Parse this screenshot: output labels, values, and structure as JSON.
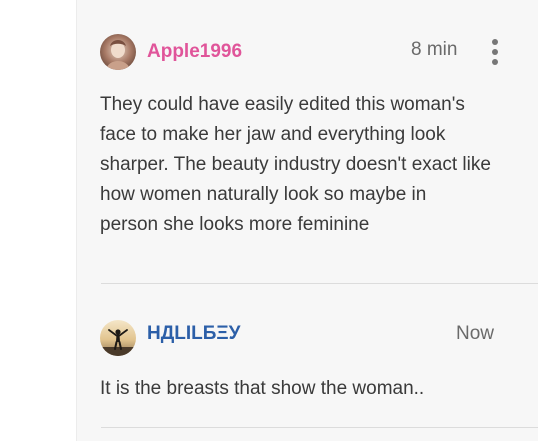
{
  "comments": [
    {
      "username": "Apple1996",
      "username_color": "#e0559a",
      "time": "8 min",
      "avatar_icon": "photo-avatar-icon",
      "lines": [
        "They could have easily edited this woman's",
        "face to make her jaw and everything look",
        "sharper. The beauty industry doesn't exact like",
        "how women naturally look so maybe in",
        "person she looks more feminine"
      ],
      "has_more_menu": true
    },
    {
      "username": "НДLILБΞУ",
      "username_color": "#2c5fa8",
      "time": "Now",
      "avatar_icon": "silhouette-avatar-icon",
      "lines": [
        "It is the breasts that show the woman.."
      ],
      "has_more_menu": false
    }
  ],
  "icons": {
    "more": "more-vertical-icon"
  }
}
